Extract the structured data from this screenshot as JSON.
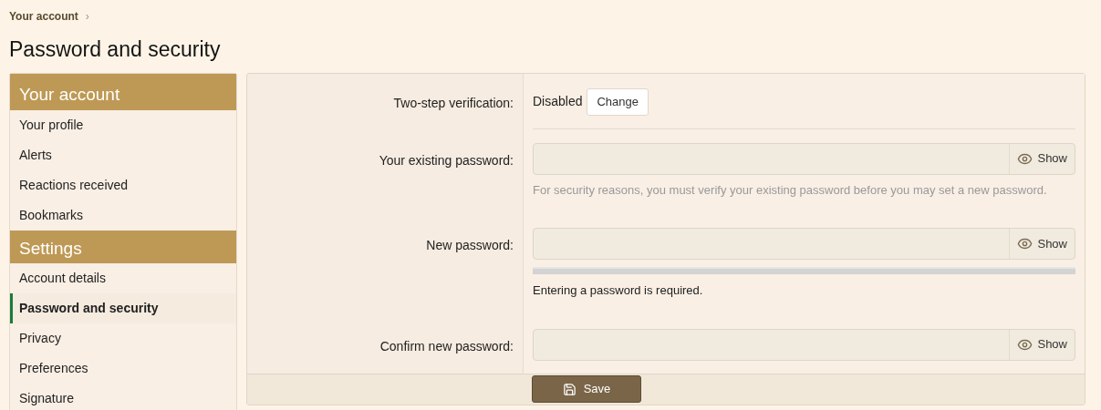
{
  "breadcrumb": {
    "label": "Your account",
    "separator": "›"
  },
  "title": "Password and security",
  "sidebar": {
    "groups": [
      {
        "header": "Your account",
        "items": [
          {
            "label": "Your profile",
            "selected": false
          },
          {
            "label": "Alerts",
            "selected": false
          },
          {
            "label": "Reactions received",
            "selected": false
          },
          {
            "label": "Bookmarks",
            "selected": false
          }
        ]
      },
      {
        "header": "Settings",
        "items": [
          {
            "label": "Account details",
            "selected": false
          },
          {
            "label": "Password and security",
            "selected": true
          },
          {
            "label": "Privacy",
            "selected": false
          },
          {
            "label": "Preferences",
            "selected": false
          },
          {
            "label": "Signature",
            "selected": false
          }
        ]
      }
    ]
  },
  "form": {
    "rows": [
      {
        "kind": "status",
        "label": "Two-step verification:",
        "value": "Disabled",
        "button": "Change"
      },
      {
        "kind": "password",
        "label": "Your existing password:",
        "toggle": "Show",
        "hint": "For security reasons, you must verify your existing password before you may set a new password."
      },
      {
        "kind": "password",
        "label": "New password:",
        "toggle": "Show",
        "meter": {
          "level": 0
        },
        "message": "Entering a password is required."
      },
      {
        "kind": "password",
        "label": "Confirm new password:",
        "toggle": "Show"
      }
    ],
    "submit": "Save"
  }
}
